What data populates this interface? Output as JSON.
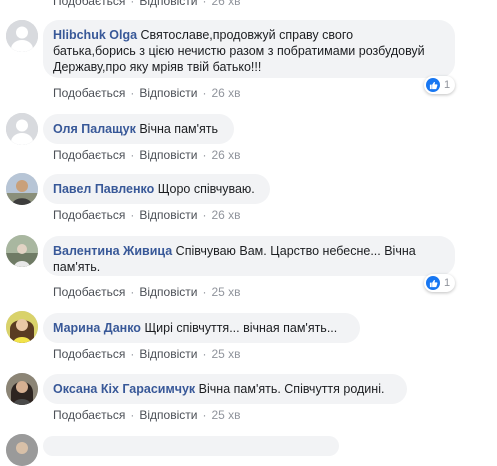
{
  "top_partial": {
    "link1": "Подобається",
    "link2": "Відповісти",
    "time": "26 хв"
  },
  "comments": [
    {
      "author": "Hlibchuk Olga",
      "lines": [
        "Святославе,продовжуй справу свого",
        "батька,борись з цією нечистю разом з побратимами розбудовуй",
        "Державу,про яку мріяв твій батько!!!"
      ],
      "like": "Подобається",
      "reply": "Відповісти",
      "time": "26 хв",
      "reactions": "1"
    },
    {
      "author": "Оля Палащук",
      "lines": [
        "Вічна пам'ять"
      ],
      "like": "Подобається",
      "reply": "Відповісти",
      "time": "26 хв"
    },
    {
      "author": "Павел Павленко",
      "lines": [
        "Щоро співчуваю."
      ],
      "like": "Подобається",
      "reply": "Відповісти",
      "time": "26 хв"
    },
    {
      "author": "Валентина Живица",
      "lines": [
        "Співчуваю Вам. Царство небесне... Вічна",
        "пам'ять."
      ],
      "like": "Подобається",
      "reply": "Відповісти",
      "time": "25 хв",
      "reactions": "1"
    },
    {
      "author": "Марина Данко",
      "lines": [
        "Щирі співчуття... вічная пам'ять..."
      ],
      "like": "Подобається",
      "reply": "Відповісти",
      "time": "25 хв"
    },
    {
      "author": "Оксана Кіх Гарасимчук",
      "lines": [
        "Вічна пам'ять. Співчуття родині."
      ],
      "like": "Подобається",
      "reply": "Відповісти",
      "time": "25 хв"
    }
  ],
  "colors": {
    "author": "#385898",
    "bubble": "#f2f3f5",
    "like": "#1877f2",
    "meta": "#90949c"
  }
}
